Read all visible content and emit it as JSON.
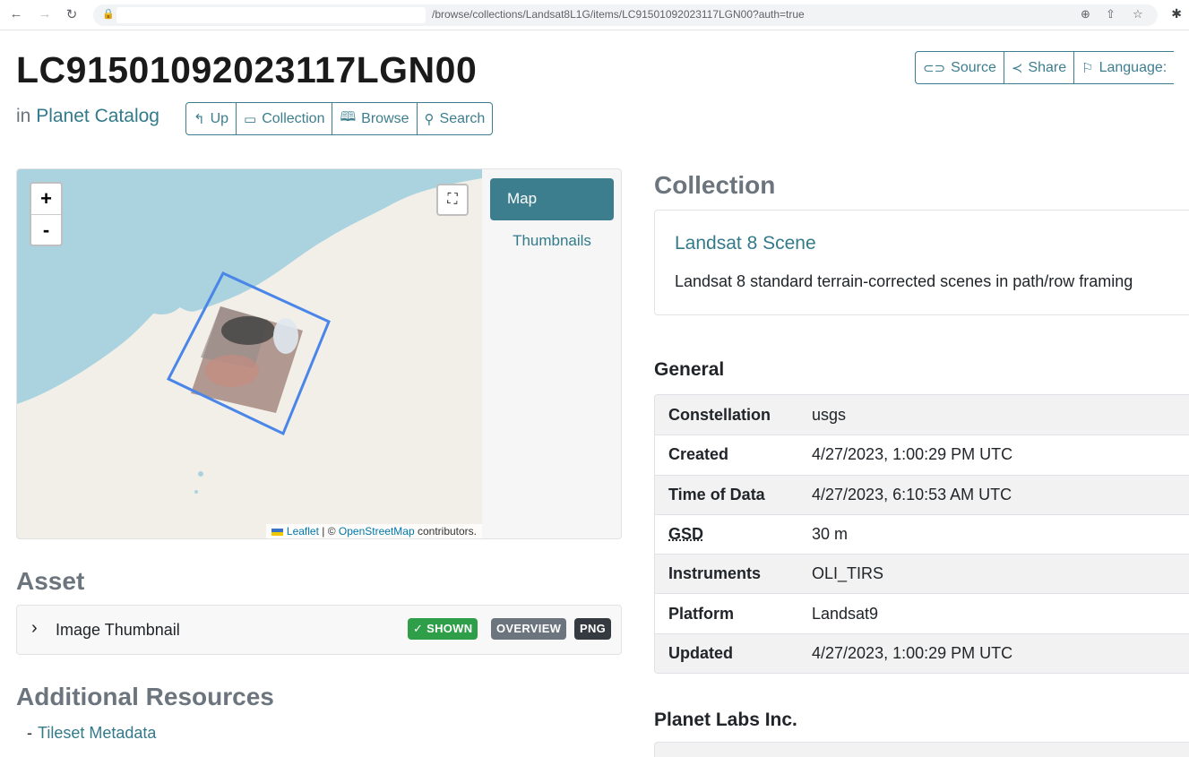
{
  "browser": {
    "url": "/browse/collections/Landsat8L1G/items/LC91501092023117LGN00?auth=true"
  },
  "header": {
    "title": "LC91501092023117LGN00",
    "catalog_prefix": "in",
    "catalog_name": "Planet Catalog",
    "nav_buttons": [
      {
        "label": "Up",
        "icon": "arrow-up-icon"
      },
      {
        "label": "Collection",
        "icon": "folder-icon"
      },
      {
        "label": "Browse",
        "icon": "book-icon"
      },
      {
        "label": "Search",
        "icon": "search-icon"
      }
    ],
    "top_buttons": [
      {
        "label": "Source",
        "icon": "link-icon"
      },
      {
        "label": "Share",
        "icon": "share-icon"
      },
      {
        "label": "Language:",
        "icon": "flag-icon"
      }
    ]
  },
  "map": {
    "zoom_in": "+",
    "zoom_out": "-",
    "attribution": {
      "leaflet": "Leaflet",
      "separator": "| ©",
      "osm": "OpenStreetMap",
      "suffix": "contributors."
    },
    "tabs": {
      "map": "Map",
      "thumbnails": "Thumbnails"
    }
  },
  "asset": {
    "heading": "Asset",
    "item_label": "Image Thumbnail",
    "badges": {
      "shown": "✓ SHOWN",
      "overview": "OVERVIEW",
      "png": "PNG"
    }
  },
  "resources": {
    "heading": "Additional Resources",
    "items": [
      {
        "bullet": "-",
        "label": "Tileset Metadata"
      }
    ]
  },
  "collection": {
    "heading": "Collection",
    "name": "Landsat 8 Scene",
    "description": "Landsat 8 standard terrain-corrected scenes in path/row framing"
  },
  "general": {
    "heading": "General",
    "rows": [
      {
        "key": "Constellation",
        "value": "usgs"
      },
      {
        "key": "Created",
        "value": "4/27/2023, 1:00:29 PM UTC"
      },
      {
        "key": "Time of Data",
        "value": "4/27/2023, 6:10:53 AM UTC"
      },
      {
        "key": "GSD",
        "value": "30 m"
      },
      {
        "key": "Instruments",
        "value": "OLI_TIRS"
      },
      {
        "key": "Platform",
        "value": "Landsat9"
      },
      {
        "key": "Updated",
        "value": "4/27/2023, 1:00:29 PM UTC"
      }
    ]
  },
  "provider": {
    "heading": "Planet Labs Inc."
  },
  "colors": {
    "accent": "#3d7e8e",
    "link": "#337a8a",
    "water": "#aad3df",
    "land": "#f2efe9",
    "footprint": "#4a86e8",
    "shown_badge": "#2e9e48"
  }
}
